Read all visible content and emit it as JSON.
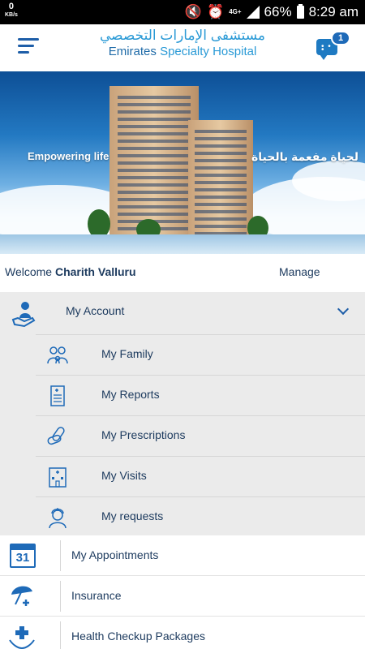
{
  "status_bar": {
    "speed_value": "0",
    "speed_unit": "KB/s",
    "network": "4G+",
    "battery": "66%",
    "time": "8:29 am"
  },
  "header": {
    "logo_arabic": "مستشفى الإمارات التخصصي",
    "logo_english_1": "Emirates",
    "logo_english_2": "Specialty Hospital",
    "chat_badge": "1"
  },
  "banner": {
    "tagline_en": "Empowering life",
    "tagline_ar": "لحياة مفعمة بالحياة"
  },
  "welcome": {
    "greeting": "Welcome",
    "user_name": "Charith Valluru",
    "manage_label": "Manage"
  },
  "account": {
    "label": "My Account",
    "items": [
      {
        "label": "My Family",
        "icon": "family-icon"
      },
      {
        "label": "My Reports",
        "icon": "report-icon"
      },
      {
        "label": "My Prescriptions",
        "icon": "pills-icon"
      },
      {
        "label": "My Visits",
        "icon": "hospital-building-icon"
      },
      {
        "label": "My requests",
        "icon": "nurse-icon"
      }
    ]
  },
  "menu": [
    {
      "label": "My Appointments",
      "icon": "calendar-icon",
      "icon_text": "31"
    },
    {
      "label": "Insurance",
      "icon": "umbrella-icon"
    },
    {
      "label": "Health Checkup Packages",
      "icon": "health-hands-icon"
    }
  ],
  "colors": {
    "primary": "#1e6ab8",
    "text": "#1c3a5e",
    "accent_light": "#2a9ad6",
    "section_bg": "#ebebeb"
  }
}
